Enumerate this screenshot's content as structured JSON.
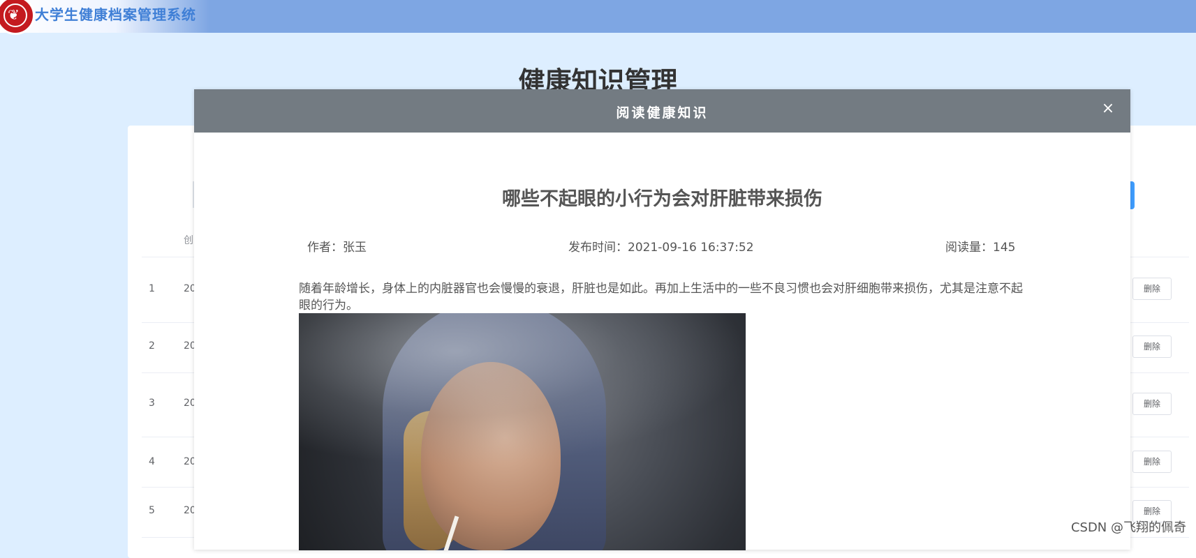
{
  "header": {
    "app_title": "大学生健康档案管理系统"
  },
  "page": {
    "title": "健康知识管理",
    "table_header_partial": "创",
    "rows": [
      {
        "index": "1",
        "date_partial": "20",
        "delete_label": "删除"
      },
      {
        "index": "2",
        "date_partial": "20",
        "delete_label": "删除"
      },
      {
        "index": "3",
        "date_partial": "20",
        "delete_label": "删除"
      },
      {
        "index": "4",
        "date_partial": "20",
        "delete_label": "删除"
      },
      {
        "index": "5",
        "date_partial": "20",
        "delete_label": "删除"
      }
    ]
  },
  "modal": {
    "title": "阅读健康知识",
    "close_glyph": "×",
    "article": {
      "title": "哪些不起眼的小行为会对肝脏带来损伤",
      "author": "作者：张玉",
      "publish_time": "发布时间：2021-09-16 16:37:52",
      "views": "阅读量：145",
      "body": "随着年龄增长，身体上的内脏器官也会慢慢的衰退，肝脏也是如此。再加上生活中的一些不良习惯也会对肝细胞带来损伤，尤其是注意不起眼的行为。"
    }
  },
  "watermark": "CSDN @飞翔的佩奇",
  "colors": {
    "topbar": "#7ea6e3",
    "page_bg": "#ddeeff",
    "modal_header": "#737b82",
    "primary": "#409eff"
  },
  "icons": {
    "logo": "university-seal-icon",
    "close": "close-icon"
  }
}
